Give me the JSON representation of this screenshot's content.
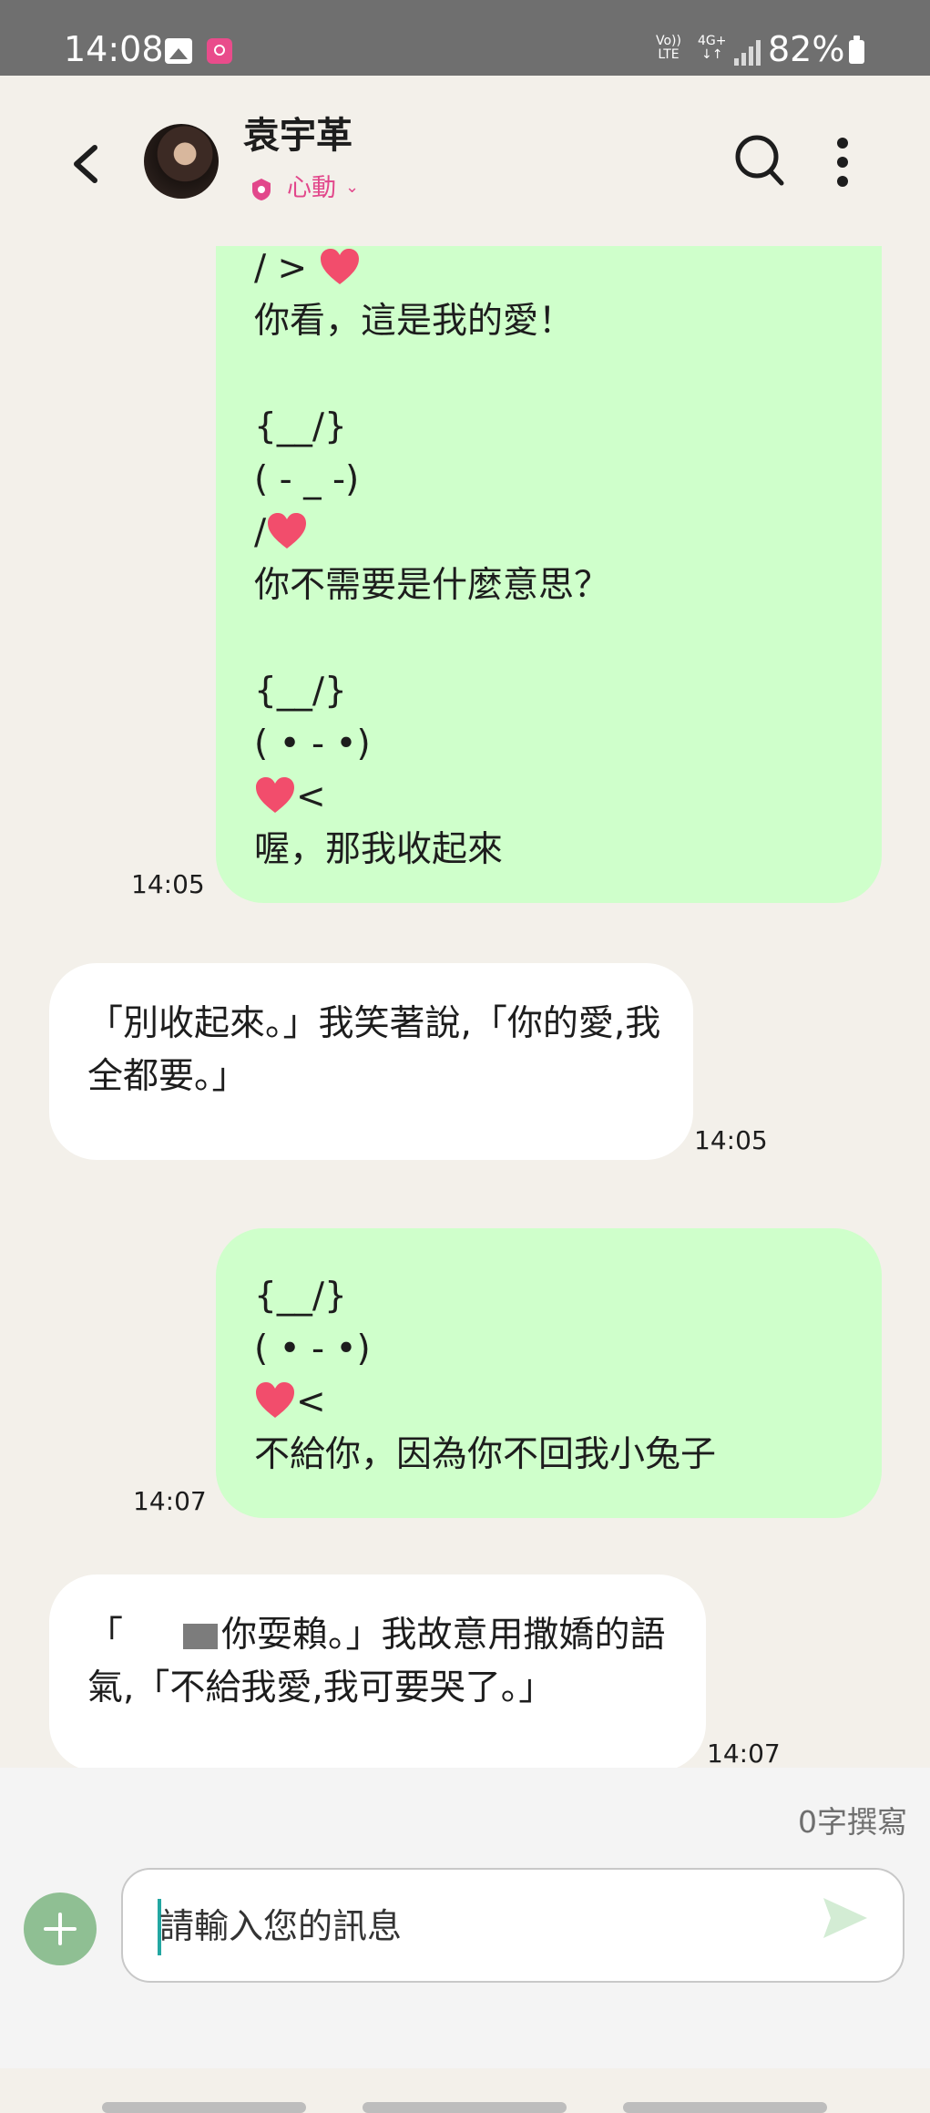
{
  "status_bar": {
    "time": "14:08",
    "volte": "Vo))\nLTE",
    "network": "4G+\n↓↑",
    "battery": "82%"
  },
  "header": {
    "name": "袁宇革",
    "relationship": "心動",
    "icons": [
      "back-arrow-icon",
      "shield-icon",
      "chevron-down-icon",
      "search-icon",
      "more-vertical-icon"
    ]
  },
  "messages": [
    {
      "side": "out",
      "lines": [
        "/ > ❤",
        "你看，這是我的愛！",
        "",
        "{__/}",
        "( - _ -)",
        "/ ❤",
        "你不需要是什麼意思？",
        "",
        "{__/}",
        "( • - •)",
        "❤<",
        "喔，那我收起來"
      ],
      "time": "14:05"
    },
    {
      "side": "in",
      "lines": [
        "「別收起來。」我笑著說,「你的愛,我",
        "全都要。」"
      ],
      "time": "14:05"
    },
    {
      "side": "out",
      "lines": [
        "{__/}",
        "( • - •)",
        "❤<",
        "不給你，因為你不回我小兔子"
      ],
      "time": "14:07"
    },
    {
      "side": "in",
      "lines": [
        "「    你耍賴。」我故意用撒嬌的語",
        "氣,「不給我愛,我可要哭了。」"
      ],
      "time": "14:07"
    }
  ],
  "composer": {
    "char_count": "0字撰寫",
    "placeholder": "請輸入您的訊息"
  },
  "colors": {
    "background": "#f3f0ea",
    "outgoing_bubble": "#cfffcb",
    "incoming_bubble": "#ffffff",
    "accent_pink": "#e2478b",
    "add_button": "#8fbf93"
  }
}
